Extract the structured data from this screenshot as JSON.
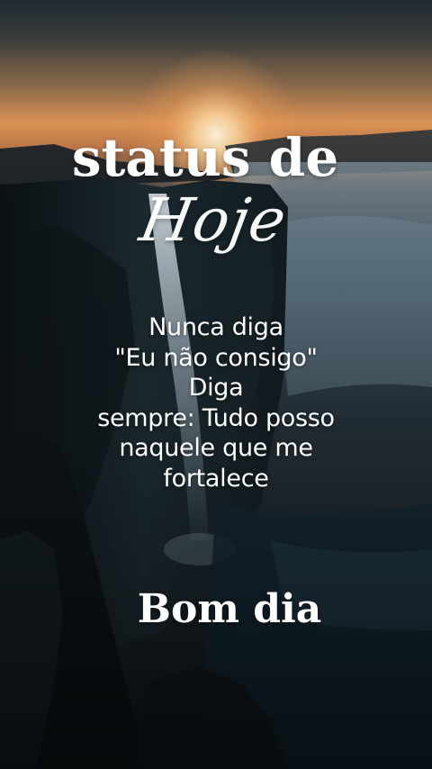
{
  "title": {
    "line1": "status de",
    "line2": "Hoje"
  },
  "quote": {
    "lines": [
      "Nunca diga",
      "\"Eu não consigo\"",
      "Diga",
      "sempre: Tudo posso",
      "naquele que me",
      "fortalece"
    ]
  },
  "greeting": "Bom dia",
  "background": {
    "scene": "waterfall-cliffs-at-sunset",
    "colors": {
      "sky_top": "#1e2a33",
      "sky_glow": "#f2a45c",
      "sun": "#fff3d6",
      "cliff_dark": "#0d1418",
      "mist": "#8aa3b3",
      "valley": "#152733"
    }
  }
}
